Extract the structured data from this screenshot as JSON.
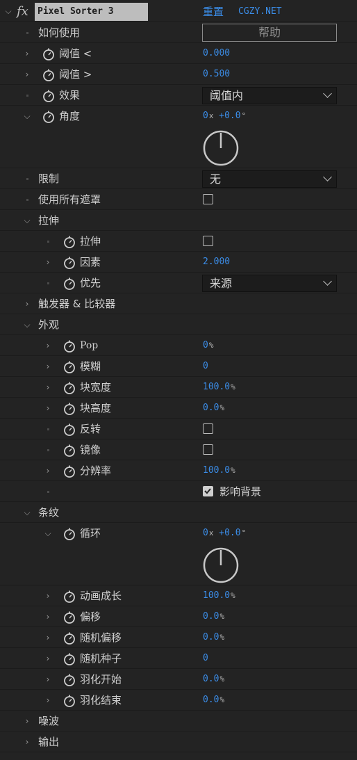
{
  "header": {
    "fx_label": "fx",
    "effect_name": "Pixel Sorter 3",
    "reset_label": "重置",
    "brand_link": "CGZY.NET"
  },
  "how_to": {
    "label": "如何使用",
    "help_button": "帮助"
  },
  "threshold_low": {
    "label": "阈值 <",
    "value": "0.000"
  },
  "threshold_high": {
    "label": "阈值 >",
    "value": "0.500"
  },
  "effect": {
    "label": "效果",
    "selected": "阈值内"
  },
  "angle": {
    "label": "角度",
    "revolutions": "0",
    "rev_unit": "x",
    "degrees": "+0.0",
    "deg_unit": "°"
  },
  "limit": {
    "label": "限制",
    "selected": "无"
  },
  "use_all_masks": {
    "label": "使用所有遮罩",
    "checked": false
  },
  "stretch_group": {
    "label": "拉伸",
    "stretch": {
      "label": "拉伸",
      "checked": false
    },
    "factor": {
      "label": "因素",
      "value": "2.000"
    },
    "priority": {
      "label": "优先",
      "selected": "来源"
    }
  },
  "triggers": {
    "label": "触发器 & 比较器"
  },
  "appearance": {
    "label": "外观",
    "pop": {
      "label": "Pop",
      "value": "0",
      "unit": "%"
    },
    "blur": {
      "label": "模糊",
      "value": "0"
    },
    "block_width": {
      "label": "块宽度",
      "value": "100.0",
      "unit": "%"
    },
    "block_height": {
      "label": "块高度",
      "value": "0.0",
      "unit": "%"
    },
    "invert": {
      "label": "反转",
      "checked": false
    },
    "mirror": {
      "label": "镜像",
      "checked": false
    },
    "resolution": {
      "label": "分辨率",
      "value": "100.0",
      "unit": "%"
    },
    "affect_background": {
      "label": "影响背景",
      "checked": true
    }
  },
  "stripes": {
    "label": "条纹",
    "loop": {
      "label": "循环",
      "revolutions": "0",
      "rev_unit": "x",
      "degrees": "+0.0",
      "deg_unit": "°"
    },
    "anim_growth": {
      "label": "动画成长",
      "value": "100.0",
      "unit": "%"
    },
    "offset": {
      "label": "偏移",
      "value": "0.0",
      "unit": "%"
    },
    "random_offset": {
      "label": "随机偏移",
      "value": "0.0",
      "unit": "%"
    },
    "random_seed": {
      "label": "随机种子",
      "value": "0"
    },
    "feather_start": {
      "label": "羽化开始",
      "value": "0.0",
      "unit": "%"
    },
    "feather_end": {
      "label": "羽化结束",
      "value": "0.0",
      "unit": "%"
    }
  },
  "noise": {
    "label": "噪波"
  },
  "output": {
    "label": "输出"
  },
  "colors": {
    "accent": "#3b8de8",
    "bg": "#232323",
    "header_bg": "#3c3c3c"
  }
}
